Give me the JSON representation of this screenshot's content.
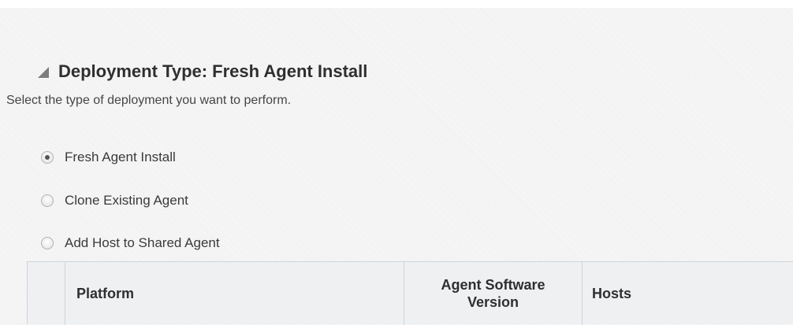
{
  "section": {
    "title": "Deployment Type: Fresh Agent Install",
    "instruction": "Select the type of deployment you want to perform."
  },
  "options": [
    {
      "label": "Fresh Agent Install",
      "selected": true
    },
    {
      "label": "Clone Existing Agent",
      "selected": false
    },
    {
      "label": "Add Host to Shared Agent",
      "selected": false
    }
  ],
  "table": {
    "columns": {
      "platform": "Platform",
      "version_line1": "Agent Software",
      "version_line2": "Version",
      "hosts": "Hosts"
    }
  },
  "colors": {
    "header_text": "#2f2f2f",
    "table_header_bg": "#eef0f2",
    "grid_line": "#cfd4da"
  }
}
